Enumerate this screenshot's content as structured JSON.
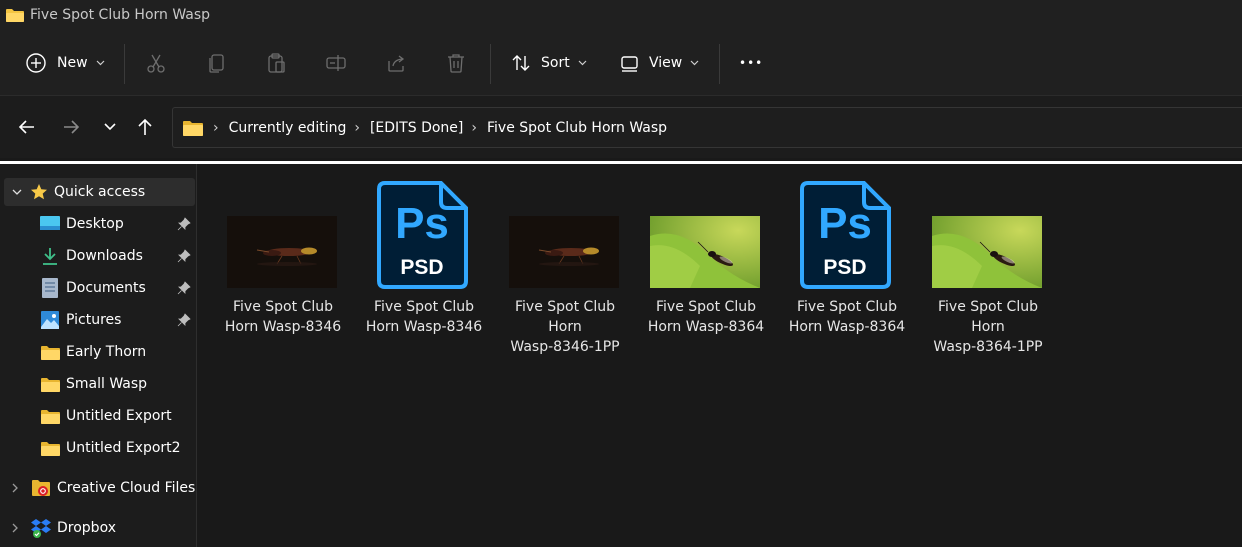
{
  "window": {
    "title": "Five Spot Club Horn Wasp"
  },
  "toolbar": {
    "new_label": "New",
    "sort_label": "Sort",
    "view_label": "View",
    "more_label": "•••"
  },
  "address": {
    "crumbs": [
      "Currently editing",
      "[EDITS Done]",
      "Five Spot Club Horn Wasp"
    ]
  },
  "sidebar": {
    "items": [
      {
        "label": "Quick access"
      },
      {
        "label": "Desktop"
      },
      {
        "label": "Downloads"
      },
      {
        "label": "Documents"
      },
      {
        "label": "Pictures"
      },
      {
        "label": "Early Thorn"
      },
      {
        "label": "Small Wasp"
      },
      {
        "label": "Untitled Export"
      },
      {
        "label": "Untitled Export2"
      },
      {
        "label": "Creative Cloud Files"
      },
      {
        "label": "Dropbox"
      }
    ]
  },
  "files": [
    {
      "line1": "Five Spot Club",
      "line2": "Horn Wasp-8346",
      "line3": "",
      "type": "photo-dark"
    },
    {
      "line1": "Five Spot Club",
      "line2": "Horn Wasp-8346",
      "line3": "",
      "type": "psd",
      "icon_text": "Ps",
      "badge": "PSD"
    },
    {
      "line1": "Five Spot Club",
      "line2": "Horn",
      "line3": "Wasp-8346-1PP",
      "type": "photo-dark"
    },
    {
      "line1": "Five Spot Club",
      "line2": "Horn Wasp-8364",
      "line3": "",
      "type": "photo-green"
    },
    {
      "line1": "Five Spot Club",
      "line2": "Horn Wasp-8364",
      "line3": "",
      "type": "psd",
      "icon_text": "Ps",
      "badge": "PSD"
    },
    {
      "line1": "Five Spot Club",
      "line2": "Horn",
      "line3": "Wasp-8364-1PP",
      "type": "photo-green"
    }
  ],
  "colors": {
    "accent": "#31a8ff",
    "psd_bg": "#001e36",
    "folder": "#f4c542"
  }
}
